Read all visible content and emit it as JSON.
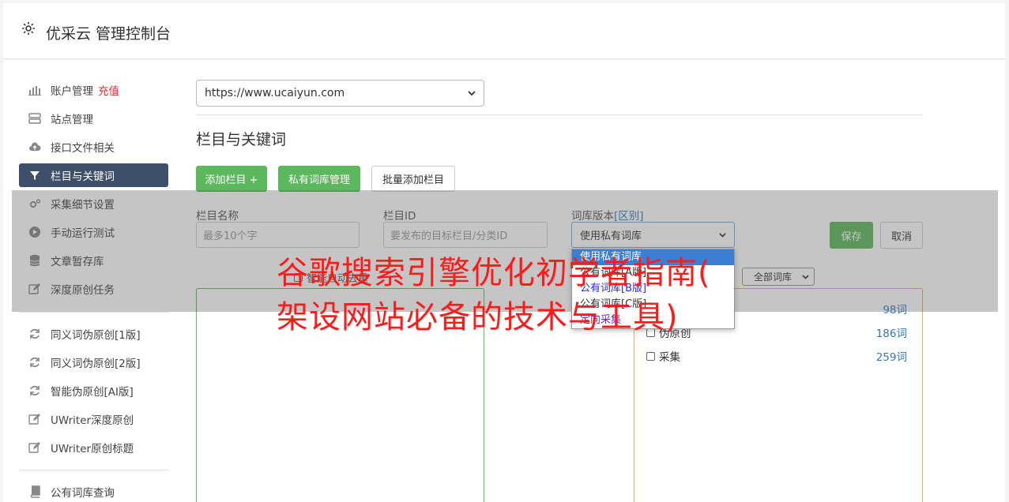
{
  "header": {
    "title": "优采云 管理控制台"
  },
  "sidebar": {
    "items": [
      {
        "label": "账户管理",
        "badge": "充值"
      },
      {
        "label": "站点管理"
      },
      {
        "label": "接口文件相关"
      },
      {
        "label": "栏目与关键词"
      },
      {
        "label": "采集细节设置"
      },
      {
        "label": "手动运行测试"
      },
      {
        "label": "文章暂存库"
      },
      {
        "label": "深度原创任务"
      },
      {
        "label": "同义词伪原创[1版]"
      },
      {
        "label": "同义词伪原创[2版]"
      },
      {
        "label": "智能伪原创[AI版]"
      },
      {
        "label": "UWriter深度原创"
      },
      {
        "label": "UWriter原创标题"
      },
      {
        "label": "公有词库查询"
      }
    ]
  },
  "site_select": {
    "value": "https://www.ucaiyun.com"
  },
  "section": {
    "title": "栏目与关键词"
  },
  "toolbar": {
    "add_column": "添加栏目 +",
    "private_lib": "私有词库管理",
    "batch_add": "批量添加栏目"
  },
  "form": {
    "column_name_label": "栏目名称",
    "column_name_placeholder": "最多10个字",
    "column_id_label": "栏目ID",
    "column_id_placeholder": "要发布的目标栏目/分类ID",
    "lib_version_label": "词库版本",
    "lib_version_link": "[区别]",
    "lib_version_value": "使用私有词库",
    "save": "保存",
    "cancel": "取消"
  },
  "dropdown": {
    "options": [
      "使用私有词库",
      "公有词库[A版]",
      "公有词库[B版]",
      "公有词库[C版]",
      "定向采集"
    ]
  },
  "dedupe": {
    "label": "智能自动去重"
  },
  "lib_filter": {
    "value": "全部词库"
  },
  "libraries": [
    {
      "name": "",
      "count": "98词"
    },
    {
      "name": "伪原创",
      "count": "186词"
    },
    {
      "name": "采集",
      "count": "259词"
    }
  ],
  "watermark": {
    "line1": "谷歌搜索引擎优化初学者指南(",
    "line2": "架设网站必备的技术与工具)"
  },
  "colors": {
    "green": "#5cb85c",
    "nav_active": "#3d4f6b",
    "orange": "#f0ad4e",
    "red": "#e52e2e"
  }
}
